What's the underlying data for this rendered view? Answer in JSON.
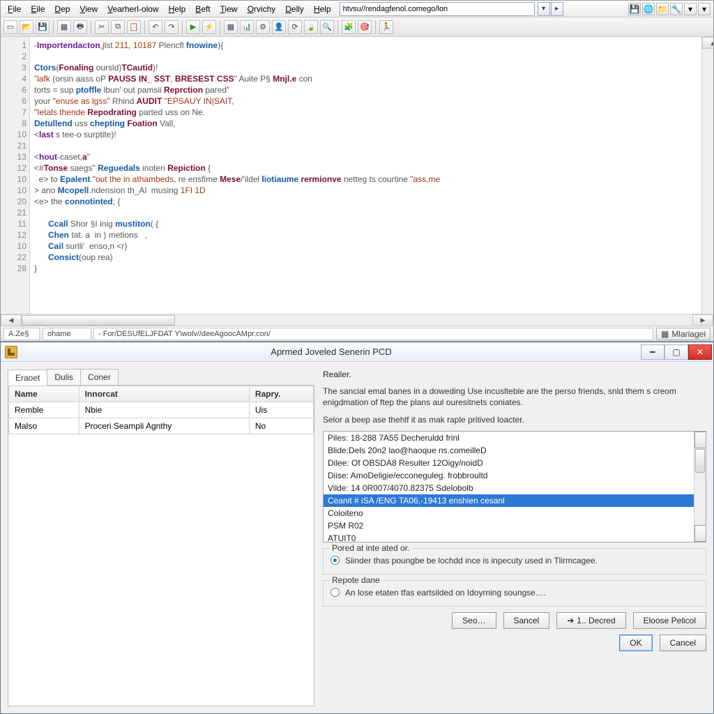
{
  "editor": {
    "menubar": [
      "File",
      "Eile",
      "Dep",
      "View",
      "Vearherl-olow",
      "Help",
      "Beft",
      "Tiew",
      "Orvichy",
      "Delly",
      "Help"
    ],
    "address": "htvsu//rendagfenol.comego/lon",
    "gutter": [
      "1",
      "2",
      "3",
      "4",
      "6",
      "6",
      "7",
      "8",
      "10",
      "21",
      "13",
      "12",
      "10",
      "10",
      "20",
      "21",
      "11",
      "12",
      "10",
      "22",
      "28"
    ],
    "code": [
      {
        "segs": [
          [
            "op",
            "-"
          ],
          [
            "kw",
            "Importendacton"
          ],
          [
            "op",
            ",jlst "
          ],
          [
            "num",
            "211"
          ],
          [
            "op",
            ", "
          ],
          [
            "num",
            "10187"
          ],
          [
            "op",
            " Plencfl "
          ],
          [
            "fn",
            "fnowine"
          ],
          [
            "op",
            "){"
          ]
        ]
      },
      {
        "segs": []
      },
      {
        "segs": [
          [
            "fn",
            "Ctors"
          ],
          [
            "op",
            "("
          ],
          [
            "id",
            "Fonaling"
          ],
          [
            "op",
            " oursld)"
          ],
          [
            "id",
            "TCautid"
          ],
          [
            "op",
            ")!"
          ]
        ]
      },
      {
        "segs": [
          [
            "str",
            "\"iafk"
          ],
          [
            "op",
            " (orsin aass oP "
          ],
          [
            "id",
            "PAUSS IN_ SST"
          ],
          [
            "op",
            ", "
          ],
          [
            "id",
            "BRESEST CSS"
          ],
          [
            "str",
            "\""
          ],
          [
            "op",
            " Auite P§ "
          ],
          [
            "id",
            "Mnjl.e"
          ],
          [
            "op",
            " con"
          ]
        ]
      },
      {
        "segs": [
          [
            "op",
            "torts = sup "
          ],
          [
            "fn",
            "ptoffle"
          ],
          [
            "op",
            " lbun' out pamsii "
          ],
          [
            "id",
            "Reprction"
          ],
          [
            "op",
            " pared"
          ],
          [
            "str",
            "\""
          ]
        ]
      },
      {
        "segs": [
          [
            "op",
            "your "
          ],
          [
            "str",
            "\"enuse as lgss\""
          ],
          [
            "op",
            " Rhind "
          ],
          [
            "id",
            "AUDIT"
          ],
          [
            "op",
            " "
          ],
          [
            "str",
            "\"EPSAUY IN|SAIT"
          ],
          [
            "op",
            ","
          ]
        ]
      },
      {
        "segs": [
          [
            "str",
            "\"Ietals thende"
          ],
          [
            "op",
            " "
          ],
          [
            "id",
            "Repodrating"
          ],
          [
            "op",
            " parted uss on Ne."
          ]
        ]
      },
      {
        "segs": [
          [
            "fn",
            "Detullend"
          ],
          [
            "op",
            " uss "
          ],
          [
            "fn",
            "chepting"
          ],
          [
            "op",
            " "
          ],
          [
            "id",
            "Foation"
          ],
          [
            "op",
            " Vall,"
          ]
        ]
      },
      {
        "segs": [
          [
            "op",
            "<"
          ],
          [
            "kw",
            "last"
          ],
          [
            "op",
            " s tee-o surptite)!"
          ]
        ]
      },
      {
        "segs": []
      },
      {
        "segs": [
          [
            "op",
            "<"
          ],
          [
            "kw",
            "hout"
          ],
          [
            "op",
            "-caset,"
          ],
          [
            "id",
            "a"
          ],
          [
            "str",
            "\""
          ]
        ]
      },
      {
        "segs": [
          [
            "op",
            "<#"
          ],
          [
            "id",
            "Tonse"
          ],
          [
            "op",
            " saegs"
          ],
          [
            "str",
            "\""
          ],
          [
            "op",
            " "
          ],
          [
            "fn",
            "Reguedals"
          ],
          [
            "op",
            " inoten "
          ],
          [
            "id",
            "Repiction"
          ],
          [
            "op",
            " {"
          ]
        ]
      },
      {
        "segs": [
          [
            "op",
            "  e> to "
          ],
          [
            "fn",
            "Epalent"
          ],
          [
            "op",
            "."
          ],
          [
            "str",
            "\"out the in athambeds"
          ],
          [
            "op",
            ", re ensfime "
          ],
          [
            "id",
            "Mese"
          ],
          [
            "op",
            "/'ildel "
          ],
          [
            "fn",
            "liotiaume"
          ],
          [
            "op",
            " "
          ],
          [
            "id",
            "rermionve"
          ],
          [
            "op",
            " netteg ts courtine "
          ],
          [
            "str",
            "\"ass,me"
          ]
        ]
      },
      {
        "segs": [
          [
            "op",
            "> ano "
          ],
          [
            "fn",
            "Mcopell"
          ],
          [
            "op",
            ".ndension th_Al  musing "
          ],
          [
            "num",
            "1FI 1D"
          ]
        ]
      },
      {
        "segs": [
          [
            "op",
            "<e> the "
          ],
          [
            "fn",
            "connotinted"
          ],
          [
            "op",
            "; {"
          ]
        ]
      },
      {
        "segs": []
      },
      {
        "segs": [
          [
            "op",
            "      "
          ],
          [
            "fn",
            "Ccall"
          ],
          [
            "op",
            " Shor §I inig "
          ],
          [
            "fn",
            "mustiton"
          ],
          [
            "op",
            "( {"
          ]
        ]
      },
      {
        "segs": [
          [
            "op",
            "      "
          ],
          [
            "fn",
            "Chen"
          ],
          [
            "op",
            " tat. a"
          ],
          [
            "op",
            "  in ) metions   ,"
          ]
        ]
      },
      {
        "segs": [
          [
            "op",
            "      "
          ],
          [
            "fn",
            "Cail"
          ],
          [
            "op",
            " surlli'  enso,n <r)"
          ]
        ]
      },
      {
        "segs": [
          [
            "op",
            "      "
          ],
          [
            "fn",
            "Consict"
          ],
          [
            "op",
            "(oup rea)"
          ]
        ]
      },
      {
        "segs": [
          [
            "op",
            "}"
          ]
        ]
      }
    ],
    "status": {
      "left_small": "A.Ze§",
      "tab": "ohame",
      "path": "- For/DESUfELJFDAT Y\\wolv//deeAgoocAMpr.con/",
      "right_btn": "Mlariagei"
    }
  },
  "dialog": {
    "title": "Aprmed Joveled Senerin PCD",
    "tabs": [
      "Eraoet",
      "Dulis",
      "Coner"
    ],
    "table": {
      "headers": [
        "Name",
        "Innorcat",
        "Rapry."
      ],
      "rows": [
        [
          "Remble",
          "Nbie",
          "Uis"
        ],
        [
          "Malso",
          "Proceri Seampli Agnthy",
          "No"
        ]
      ]
    },
    "right": {
      "heading": "Reailer.",
      "p1": "The sancial emal banes in a doweding Use incuslteble are the perso friends, snld them s creom enigdmation of ftep the plans aul ouresitnets coniates.",
      "p2": "Selor a beep ase thehlf it as mak raple pritived loacter.",
      "list": [
        "Piles: 18-288 7A55 Decheruldd frinl",
        "Blide:Dels 20n2 lao@haoque ns.comeilleD",
        "Dilee: Of OBSDA8 Resulter 12Oigy/noidD",
        "Diise: AmoDeligie/ecconeguleg. frobbroultd",
        "Vilde: 14 0R007/4070.82375 Sdelobolb",
        "Ceanit # iSA /ENG TA06,-19413 enshien cesanl",
        "Coloiteno",
        "PSM R02",
        "ATUIT0"
      ],
      "list_selected_index": 5,
      "group1": {
        "legend": "Pored at inte ated or.",
        "radio": "Siinder thas poungbe be lochdd ince is inpecuty used in Tlirmcagee."
      },
      "group2": {
        "legend": "Repote dane",
        "radio": "An lose etaten tfas eartsilded on Idoyrning soungse…."
      }
    },
    "buttons": {
      "seo": "Seo…",
      "sancel": "Sancel",
      "decred": "1.. Decred",
      "eloose": "Eloose Pelicol",
      "ok": "OK",
      "cancel": "Cancel"
    }
  }
}
